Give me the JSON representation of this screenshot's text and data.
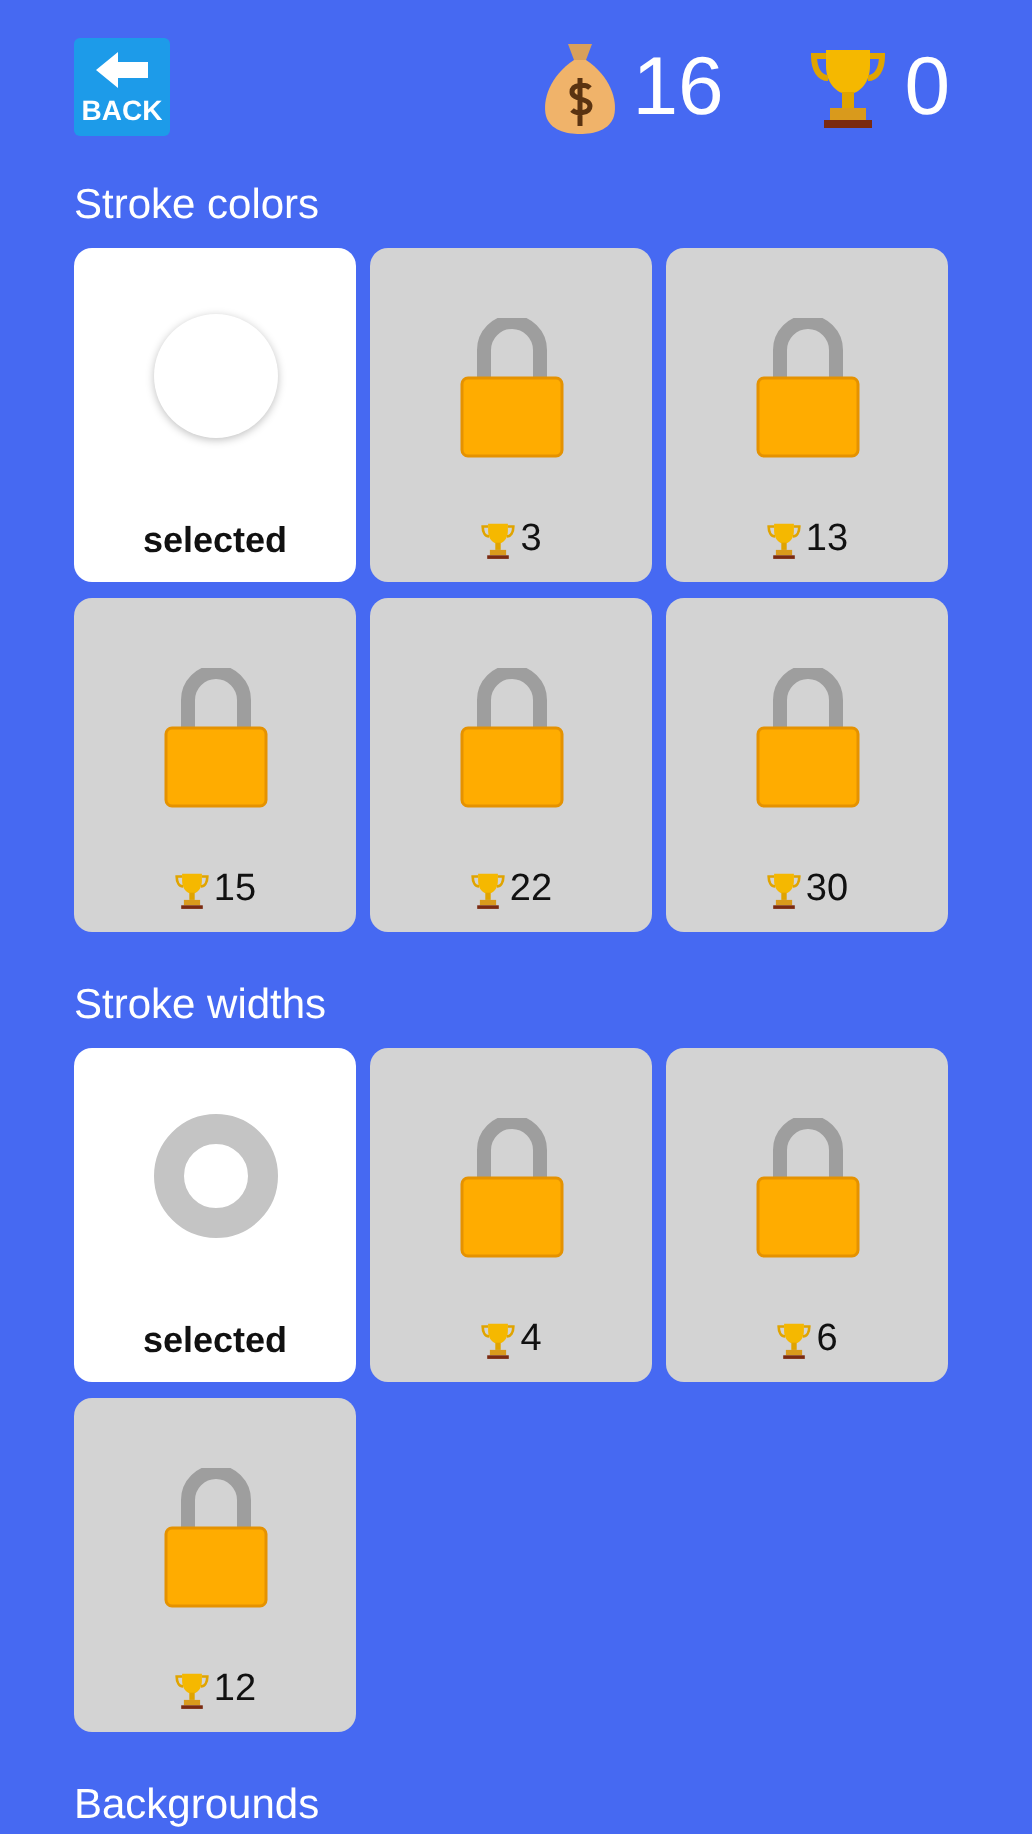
{
  "header": {
    "back_button": {
      "label": "BACK"
    },
    "coins": "16",
    "trophies": "0"
  },
  "sections": [
    {
      "title": "Stroke colors",
      "items": [
        {
          "kind": "color_swatch",
          "selected": true,
          "label": "selected"
        },
        {
          "kind": "locked",
          "selected": false,
          "cost": "3"
        },
        {
          "kind": "locked",
          "selected": false,
          "cost": "13"
        },
        {
          "kind": "locked",
          "selected": false,
          "cost": "15"
        },
        {
          "kind": "locked",
          "selected": false,
          "cost": "22"
        },
        {
          "kind": "locked",
          "selected": false,
          "cost": "30"
        }
      ]
    },
    {
      "title": "Stroke widths",
      "items": [
        {
          "kind": "width_swatch",
          "selected": true,
          "label": "selected"
        },
        {
          "kind": "locked",
          "selected": false,
          "cost": "4"
        },
        {
          "kind": "locked",
          "selected": false,
          "cost": "6"
        },
        {
          "kind": "locked",
          "selected": false,
          "cost": "12"
        }
      ]
    },
    {
      "title": "Backgrounds"
    }
  ]
}
